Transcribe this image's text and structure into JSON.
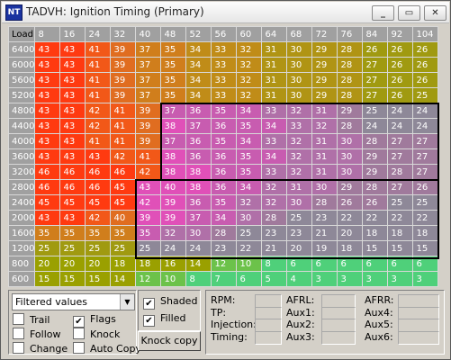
{
  "window": {
    "title": "TADVH: Ignition Timing (Primary)",
    "icon_text": "NT",
    "buttons": {
      "minimize": "_",
      "restore": "▭",
      "close": "✕"
    }
  },
  "table": {
    "corner_label": "Load",
    "columns": [
      "8",
      "16",
      "24",
      "32",
      "40",
      "48",
      "52",
      "56",
      "60",
      "64",
      "68",
      "72",
      "76",
      "84",
      "92",
      "104"
    ],
    "rows": [
      {
        "label": "6400",
        "values": [
          "43",
          "43",
          "41",
          "39",
          "37",
          "35",
          "34",
          "33",
          "32",
          "31",
          "30",
          "29",
          "28",
          "26",
          "26",
          "26"
        ]
      },
      {
        "label": "6000",
        "values": [
          "43",
          "43",
          "41",
          "39",
          "37",
          "35",
          "34",
          "33",
          "32",
          "31",
          "30",
          "29",
          "28",
          "27",
          "26",
          "26"
        ]
      },
      {
        "label": "5600",
        "values": [
          "43",
          "43",
          "41",
          "39",
          "37",
          "35",
          "34",
          "33",
          "32",
          "31",
          "30",
          "29",
          "28",
          "27",
          "26",
          "26"
        ]
      },
      {
        "label": "5200",
        "values": [
          "43",
          "43",
          "41",
          "39",
          "37",
          "35",
          "34",
          "33",
          "32",
          "31",
          "30",
          "29",
          "28",
          "27",
          "26",
          "25"
        ]
      },
      {
        "label": "4800",
        "values": [
          "43",
          "43",
          "42",
          "41",
          "39",
          "37",
          "36",
          "35",
          "34",
          "33",
          "32",
          "31",
          "29",
          "25",
          "24",
          "24"
        ]
      },
      {
        "label": "4400",
        "values": [
          "43",
          "43",
          "42",
          "41",
          "39",
          "38",
          "37",
          "36",
          "35",
          "34",
          "33",
          "32",
          "28",
          "24",
          "24",
          "24"
        ]
      },
      {
        "label": "4000",
        "values": [
          "43",
          "43",
          "41",
          "41",
          "39",
          "37",
          "36",
          "35",
          "34",
          "33",
          "32",
          "31",
          "30",
          "28",
          "27",
          "27"
        ]
      },
      {
        "label": "3600",
        "values": [
          "43",
          "43",
          "43",
          "42",
          "41",
          "38",
          "36",
          "36",
          "35",
          "34",
          "32",
          "31",
          "30",
          "29",
          "27",
          "27"
        ]
      },
      {
        "label": "3200",
        "values": [
          "46",
          "46",
          "46",
          "46",
          "42",
          "38",
          "38",
          "36",
          "35",
          "33",
          "32",
          "31",
          "30",
          "29",
          "28",
          "27"
        ]
      },
      {
        "label": "2800",
        "values": [
          "46",
          "46",
          "46",
          "45",
          "43",
          "40",
          "38",
          "36",
          "34",
          "32",
          "31",
          "30",
          "29",
          "28",
          "27",
          "26"
        ]
      },
      {
        "label": "2400",
        "values": [
          "45",
          "45",
          "45",
          "45",
          "42",
          "39",
          "36",
          "35",
          "32",
          "32",
          "30",
          "28",
          "26",
          "26",
          "25",
          "25"
        ]
      },
      {
        "label": "2000",
        "values": [
          "43",
          "43",
          "42",
          "40",
          "39",
          "39",
          "37",
          "34",
          "30",
          "28",
          "25",
          "23",
          "22",
          "22",
          "22",
          "22"
        ]
      },
      {
        "label": "1600",
        "values": [
          "35",
          "35",
          "35",
          "35",
          "35",
          "32",
          "30",
          "28",
          "25",
          "23",
          "23",
          "21",
          "20",
          "18",
          "18",
          "18"
        ]
      },
      {
        "label": "1200",
        "values": [
          "25",
          "25",
          "25",
          "25",
          "25",
          "24",
          "24",
          "23",
          "22",
          "21",
          "20",
          "19",
          "18",
          "15",
          "15",
          "15"
        ]
      },
      {
        "label": "800",
        "values": [
          "20",
          "20",
          "20",
          "18",
          "18",
          "16",
          "14",
          "12",
          "10",
          "8",
          "6",
          "6",
          "6",
          "6",
          "6",
          "6"
        ]
      },
      {
        "label": "600",
        "values": [
          "15",
          "15",
          "15",
          "14",
          "12",
          "10",
          "8",
          "7",
          "6",
          "5",
          "4",
          "3",
          "3",
          "3",
          "3",
          "3"
        ]
      }
    ]
  },
  "colors": {
    "header": "#a0a0a0",
    "cell_text": "#ffffff",
    "selection_border": "#000000"
  },
  "controls": {
    "filter_select": {
      "value": "Filtered values"
    },
    "checkboxes": [
      {
        "label": "Trail",
        "checked": false
      },
      {
        "label": "Flags",
        "checked": true
      },
      {
        "label": "Follow",
        "checked": false
      },
      {
        "label": "Knock",
        "checked": false
      },
      {
        "label": "Change",
        "checked": false
      },
      {
        "label": "Auto Copy",
        "checked": false
      }
    ],
    "shaded": {
      "label": "Shaded",
      "checked": true
    },
    "filled": {
      "label": "Filled",
      "checked": true
    },
    "knock_copy_label": "Knock copy"
  },
  "readouts": {
    "col1": [
      "RPM:",
      "TP:",
      "Injection:",
      "Timing:"
    ],
    "col2": [
      "AFRL:",
      "Aux1:",
      "Aux2:",
      "Aux3:"
    ],
    "col3": [
      "AFRR:",
      "Aux4:",
      "Aux5:",
      "Aux6:"
    ],
    "check_mark": "✔"
  }
}
